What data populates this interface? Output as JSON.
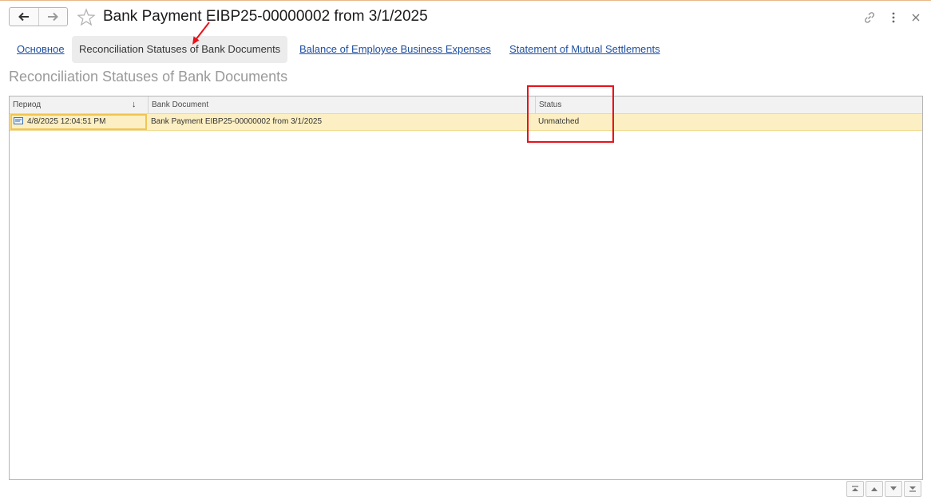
{
  "window": {
    "title": "Bank Payment EIBP25-00000002 from 3/1/2025",
    "back_icon": "arrow-left-icon",
    "forward_icon": "arrow-right-icon",
    "favorite_icon": "star-outline-icon",
    "link_icon": "link-icon",
    "more_icon": "more-vertical-icon",
    "close_icon": "close-icon"
  },
  "tabs": [
    {
      "label": "Основное",
      "active": false
    },
    {
      "label": "Reconciliation Statuses of Bank Documents",
      "active": true
    },
    {
      "label": "Balance of Employee Business Expenses",
      "active": false
    },
    {
      "label": "Statement of Mutual Settlements",
      "active": false
    }
  ],
  "section_title": "Reconciliation Statuses of Bank Documents",
  "table": {
    "columns": [
      "Период",
      "Bank Document",
      "Status"
    ],
    "sort_indicator": "↓",
    "rows": [
      {
        "period": "4/8/2025 12:04:51 PM",
        "bank_document": "Bank Payment EIBP25-00000002 from 3/1/2025",
        "status": "Unmatched",
        "icon": "document-record-icon"
      }
    ]
  },
  "scroll_buttons": [
    "scroll-top-icon",
    "scroll-up-icon",
    "scroll-down-icon",
    "scroll-bottom-icon"
  ],
  "colors": {
    "link": "#1f4fa0",
    "selected_row": "#fcefc3",
    "annotation_red": "#e8121a"
  }
}
